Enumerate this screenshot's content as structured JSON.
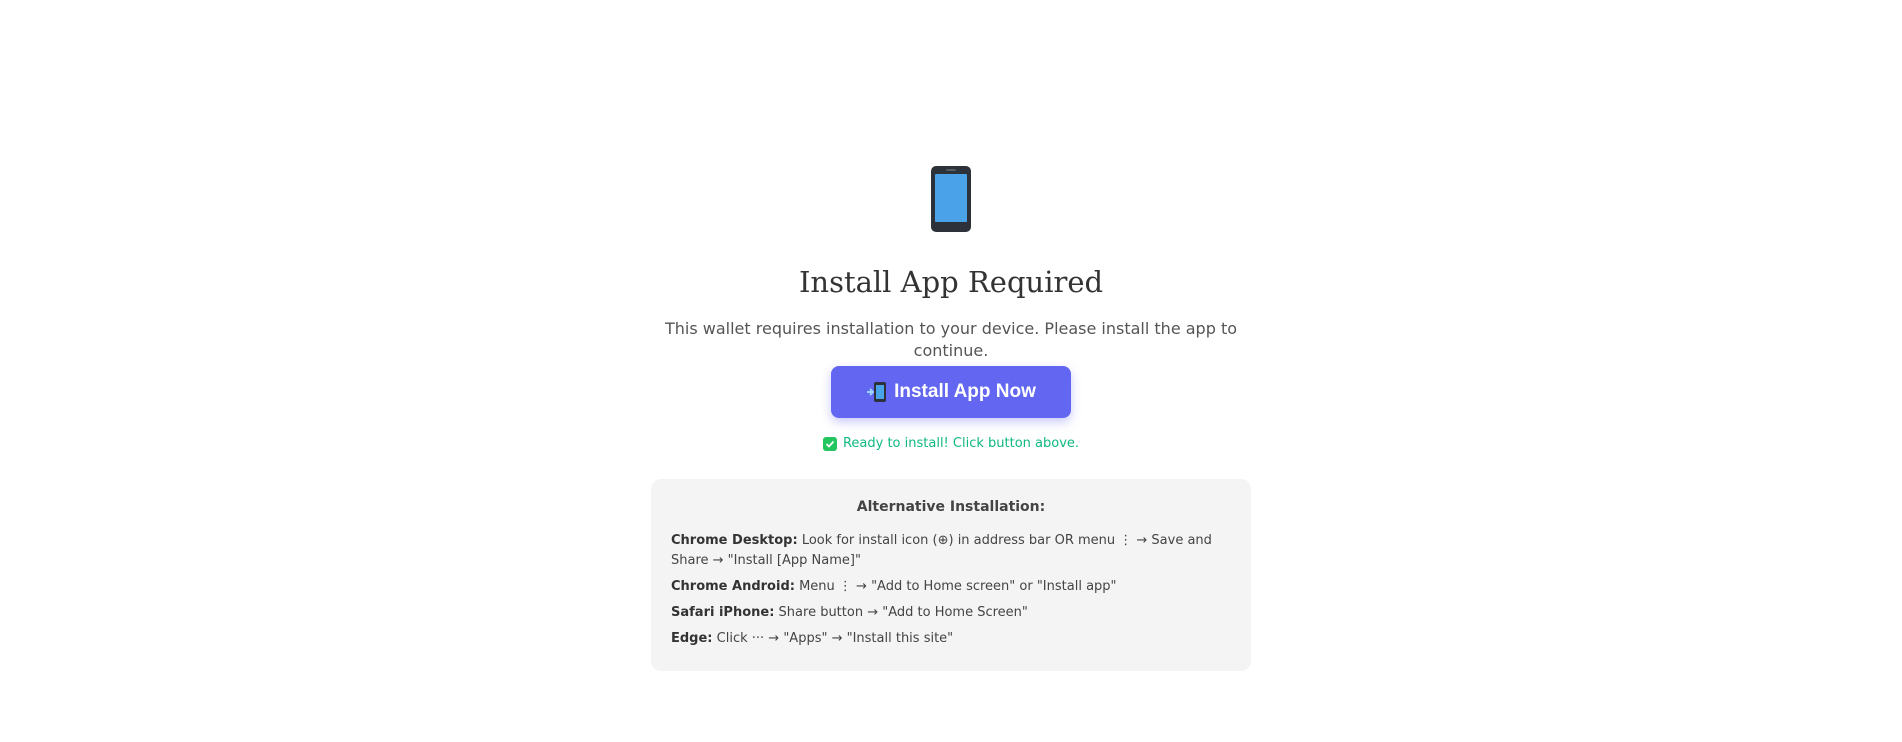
{
  "header": {
    "icon": "mobile-phone-icon",
    "title": "Install App Required",
    "subtitle": "This wallet requires installation to your device. Please install the app to continue."
  },
  "install_button": {
    "icon": "mobile-arrow-icon",
    "label": "Install App Now",
    "color": "#6366f1"
  },
  "status": {
    "icon": "check-box-icon",
    "text": "Ready to install! Click button above.",
    "color": "#10b981"
  },
  "alternative": {
    "title": "Alternative Installation:",
    "items": [
      {
        "platform": "Chrome Desktop:",
        "text": "Look for install icon (⊕) in address bar OR menu ⋮ → Save and Share → \"Install [App Name]\""
      },
      {
        "platform": "Chrome Android:",
        "text": "Menu ⋮ → \"Add to Home screen\" or \"Install app\""
      },
      {
        "platform": "Safari iPhone:",
        "text": "Share button → \"Add to Home Screen\""
      },
      {
        "platform": "Edge:",
        "text": "Click ··· → \"Apps\" → \"Install this site\""
      }
    ]
  }
}
